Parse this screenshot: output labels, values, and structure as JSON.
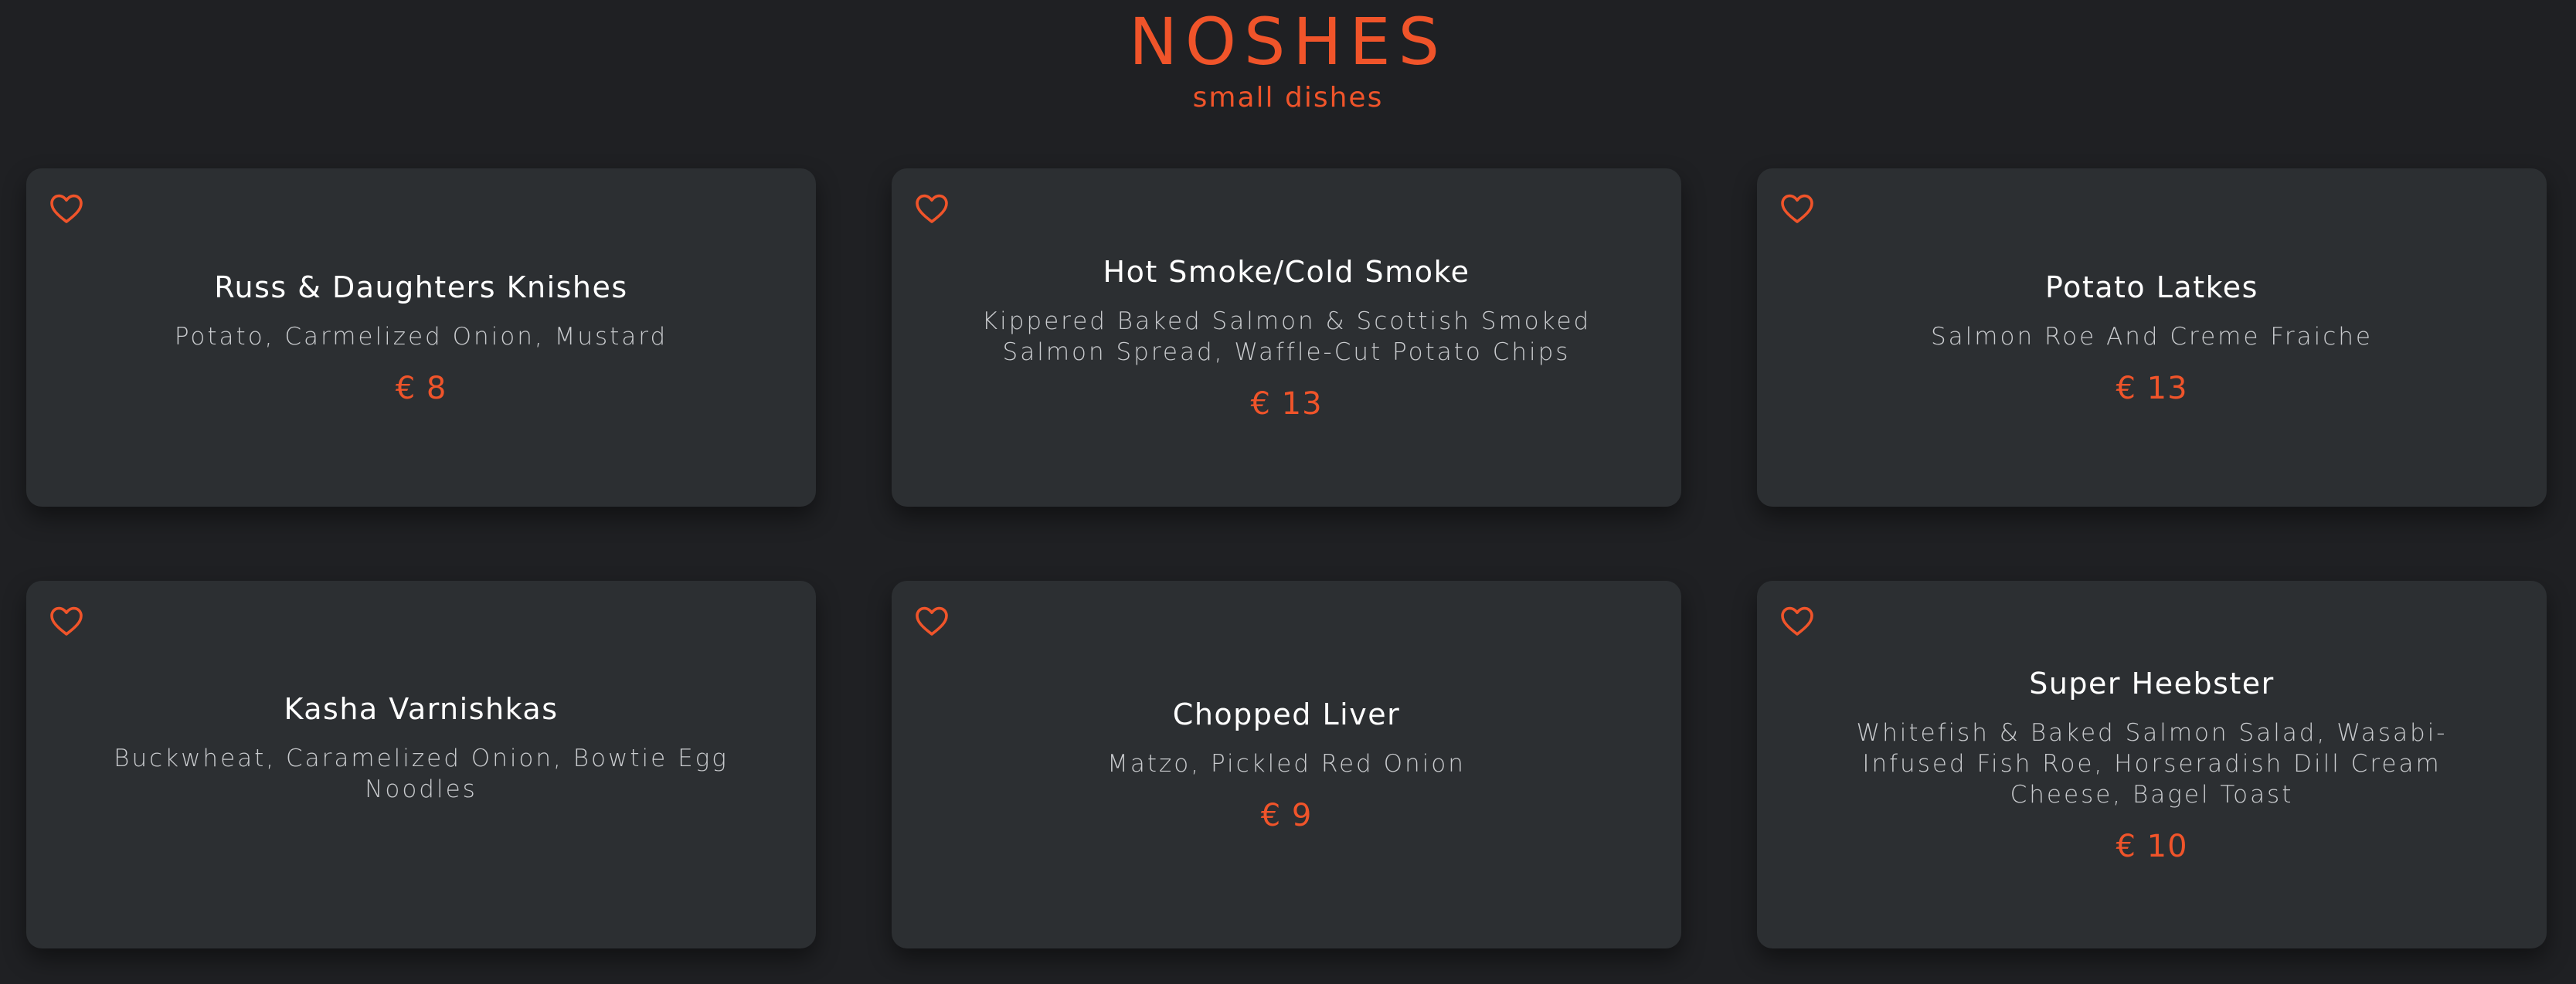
{
  "header": {
    "title": "NOSHES",
    "subtitle": "small dishes"
  },
  "colors": {
    "background": "#1f2023",
    "card": "#2c2f32",
    "accent": "#f0542a",
    "text": "#ffffff",
    "muted": "#c9cbce"
  },
  "cards": [
    {
      "name": "Russ & Daughters Knishes",
      "description": "Potato, Carmelized Onion, Mustard",
      "price": "€ 8",
      "icon": "heart-outline-icon"
    },
    {
      "name": "Hot Smoke/Cold Smoke",
      "description": "Kippered Baked Salmon & Scottish Smoked Salmon Spread, Waffle-Cut Potato Chips",
      "price": "€ 13",
      "icon": "heart-outline-icon"
    },
    {
      "name": "Potato Latkes",
      "description": "Salmon Roe And Creme Fraiche",
      "price": "€ 13",
      "icon": "heart-outline-icon"
    },
    {
      "name": "Kasha Varnishkas",
      "description": "Buckwheat, Caramelized Onion, Bowtie Egg Noodles",
      "price": "",
      "icon": "heart-outline-icon"
    },
    {
      "name": "Chopped Liver",
      "description": "Matzo, Pickled Red Onion",
      "price": "€ 9",
      "icon": "heart-outline-icon"
    },
    {
      "name": "Super Heebster",
      "description": "Whitefish & Baked Salmon Salad, Wasabi-Infused Fish Roe, Horseradish Dill Cream Cheese, Bagel Toast",
      "price": "€ 10",
      "icon": "heart-outline-icon"
    }
  ]
}
